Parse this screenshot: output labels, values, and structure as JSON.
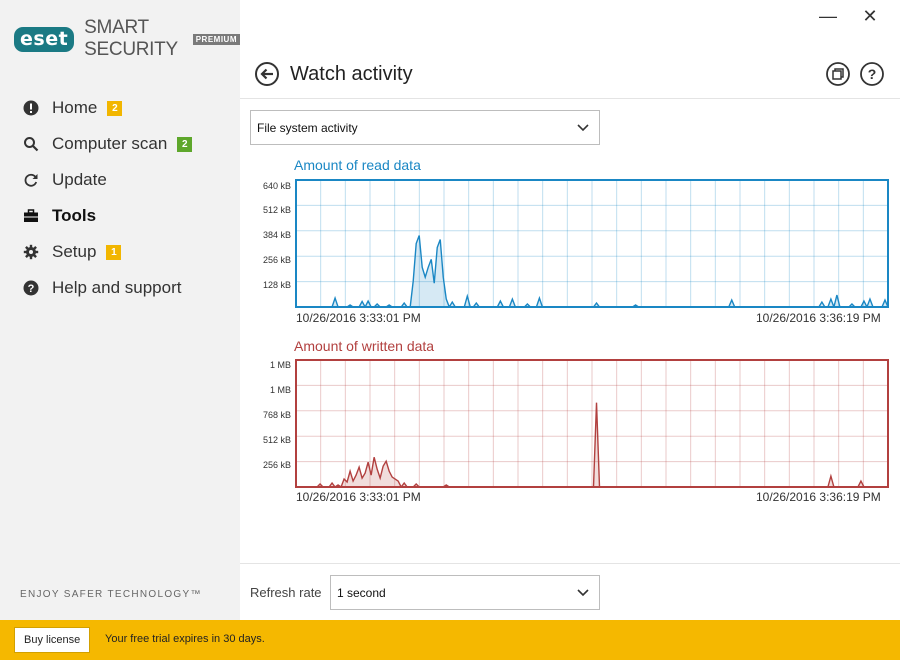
{
  "app": {
    "brand": "eset",
    "product": "SMART SECURITY",
    "edition": "PREMIUM",
    "accent": "#1b7a84",
    "tagline": "ENJOY SAFER TECHNOLOGY™"
  },
  "window": {
    "minimize_label": "—",
    "close_label": "✕"
  },
  "sidebar": {
    "items": [
      {
        "label": "Home",
        "icon": "alert-circle-icon",
        "badge": "2",
        "badge_color": "#f2b600",
        "active": false
      },
      {
        "label": "Computer scan",
        "icon": "search-icon",
        "badge": "2",
        "badge_color": "#5ea72b",
        "active": false
      },
      {
        "label": "Update",
        "icon": "refresh-icon",
        "badge": null,
        "active": false
      },
      {
        "label": "Tools",
        "icon": "toolbox-icon",
        "badge": null,
        "active": true
      },
      {
        "label": "Setup",
        "icon": "gear-icon",
        "badge": "1",
        "badge_color": "#f2b600",
        "active": false
      },
      {
        "label": "Help and support",
        "icon": "help-circle-icon",
        "badge": null,
        "active": false
      }
    ]
  },
  "header": {
    "title": "Watch activity",
    "icons": [
      "back-arrow-icon",
      "copy-window-icon",
      "help-icon"
    ]
  },
  "activity_select": {
    "value": "File system activity"
  },
  "refresh": {
    "label": "Refresh rate",
    "value": "1 second"
  },
  "footer": {
    "buy_label": "Buy license",
    "trial_text": "Your free trial expires in 30 days.",
    "color": "#f5b800"
  },
  "chart_data": [
    {
      "type": "area",
      "title": "Amount of read data",
      "color": "#1a87c4",
      "y_ticks": [
        "128 kB",
        "256 kB",
        "384 kB",
        "512 kB",
        "640 kB"
      ],
      "ylim": [
        0,
        640
      ],
      "y_unit": "kB",
      "grid": true,
      "x_start_label": "10/26/2016 3:33:01 PM",
      "x_end_label": "10/26/2016 3:36:19 PM",
      "x_count": 198,
      "spikes": [
        {
          "x": 13,
          "y": 45
        },
        {
          "x": 18,
          "y": 10
        },
        {
          "x": 22,
          "y": 28
        },
        {
          "x": 24,
          "y": 30
        },
        {
          "x": 27,
          "y": 15
        },
        {
          "x": 31,
          "y": 10
        },
        {
          "x": 36,
          "y": 20
        },
        {
          "x": 39,
          "y": 130
        },
        {
          "x": 40,
          "y": 320
        },
        {
          "x": 41,
          "y": 360
        },
        {
          "x": 42,
          "y": 200
        },
        {
          "x": 43,
          "y": 150
        },
        {
          "x": 44,
          "y": 200
        },
        {
          "x": 45,
          "y": 240
        },
        {
          "x": 46,
          "y": 120
        },
        {
          "x": 47,
          "y": 300
        },
        {
          "x": 48,
          "y": 340
        },
        {
          "x": 49,
          "y": 150
        },
        {
          "x": 50,
          "y": 40
        },
        {
          "x": 52,
          "y": 25
        },
        {
          "x": 57,
          "y": 55
        },
        {
          "x": 60,
          "y": 20
        },
        {
          "x": 68,
          "y": 30
        },
        {
          "x": 72,
          "y": 40
        },
        {
          "x": 77,
          "y": 15
        },
        {
          "x": 81,
          "y": 45
        },
        {
          "x": 100,
          "y": 20
        },
        {
          "x": 113,
          "y": 10
        },
        {
          "x": 145,
          "y": 35
        },
        {
          "x": 175,
          "y": 25
        },
        {
          "x": 178,
          "y": 40
        },
        {
          "x": 180,
          "y": 60
        },
        {
          "x": 185,
          "y": 15
        },
        {
          "x": 189,
          "y": 30
        },
        {
          "x": 191,
          "y": 40
        },
        {
          "x": 196,
          "y": 35
        }
      ]
    },
    {
      "type": "area",
      "title": "Amount of written data",
      "color": "#b2403f",
      "y_ticks": [
        "256 kB",
        "512 kB",
        "768 kB",
        "1 MB",
        "1 MB"
      ],
      "ylim": [
        0,
        1280
      ],
      "y_unit": "kB",
      "grid": true,
      "x_start_label": "10/26/2016 3:33:01 PM",
      "x_end_label": "10/26/2016 3:36:19 PM",
      "x_count": 198,
      "spikes": [
        {
          "x": 8,
          "y": 30
        },
        {
          "x": 12,
          "y": 40
        },
        {
          "x": 14,
          "y": 20
        },
        {
          "x": 16,
          "y": 80
        },
        {
          "x": 17,
          "y": 50
        },
        {
          "x": 18,
          "y": 160
        },
        {
          "x": 19,
          "y": 60
        },
        {
          "x": 20,
          "y": 120
        },
        {
          "x": 21,
          "y": 200
        },
        {
          "x": 22,
          "y": 90
        },
        {
          "x": 23,
          "y": 140
        },
        {
          "x": 24,
          "y": 250
        },
        {
          "x": 25,
          "y": 120
        },
        {
          "x": 26,
          "y": 300
        },
        {
          "x": 27,
          "y": 180
        },
        {
          "x": 28,
          "y": 90
        },
        {
          "x": 29,
          "y": 210
        },
        {
          "x": 30,
          "y": 260
        },
        {
          "x": 31,
          "y": 160
        },
        {
          "x": 32,
          "y": 100
        },
        {
          "x": 33,
          "y": 80
        },
        {
          "x": 34,
          "y": 60
        },
        {
          "x": 36,
          "y": 40
        },
        {
          "x": 40,
          "y": 30
        },
        {
          "x": 50,
          "y": 20
        },
        {
          "x": 100,
          "y": 850
        },
        {
          "x": 178,
          "y": 110
        },
        {
          "x": 188,
          "y": 60
        }
      ]
    }
  ]
}
